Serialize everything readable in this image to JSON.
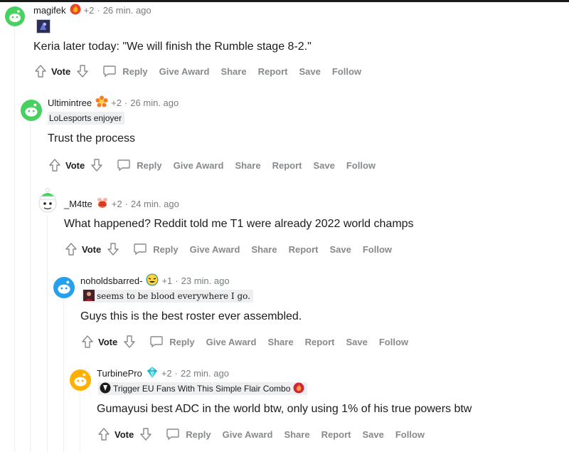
{
  "actions": {
    "vote": "Vote",
    "reply": "Reply",
    "give_award": "Give Award",
    "share": "Share",
    "report": "Report",
    "save": "Save",
    "follow": "Follow"
  },
  "comments": [
    {
      "username": "magifek",
      "karma": "+2",
      "separator": "·",
      "time": "26 min. ago",
      "flair_text": "",
      "body": "Keria later today: \"We will finish the Rumble stage 8-2.\"",
      "avatar_color": "#46d160"
    },
    {
      "username": "Ultimintree",
      "karma": "+2",
      "separator": "·",
      "time": "26 min. ago",
      "flair_text": "LoLesports enjoyer",
      "body": "Trust the process",
      "avatar_color": "#46d160"
    },
    {
      "username": "_M4tte",
      "karma": "+2",
      "separator": "·",
      "time": "24 min. ago",
      "flair_text": "",
      "body": "What happened? Reddit told me T1 were already 2022 world champs",
      "avatar_color": "#46d160"
    },
    {
      "username": "noholdsbarred-",
      "karma": "+1",
      "separator": "·",
      "time": "23 min. ago",
      "flair_text": "seems to be blood everywhere I go.",
      "body": "Guys this is the best roster ever assembled.",
      "avatar_color": "#24a0ed"
    },
    {
      "username": "TurbinePro",
      "karma": "+2",
      "separator": "·",
      "time": "22 min. ago",
      "flair_text": "Trigger EU Fans With This Simple Flair Combo",
      "body": "Gumayusi best ADC in the world btw, only using 1% of his true powers btw",
      "avatar_color": "#ffb000"
    }
  ],
  "colors": {
    "meta_gray": "#787c7e",
    "action_gray": "#878a8c",
    "thread_line": "#edeff1",
    "flair_bg": "#edeff1",
    "text": "#1c1c1c"
  }
}
